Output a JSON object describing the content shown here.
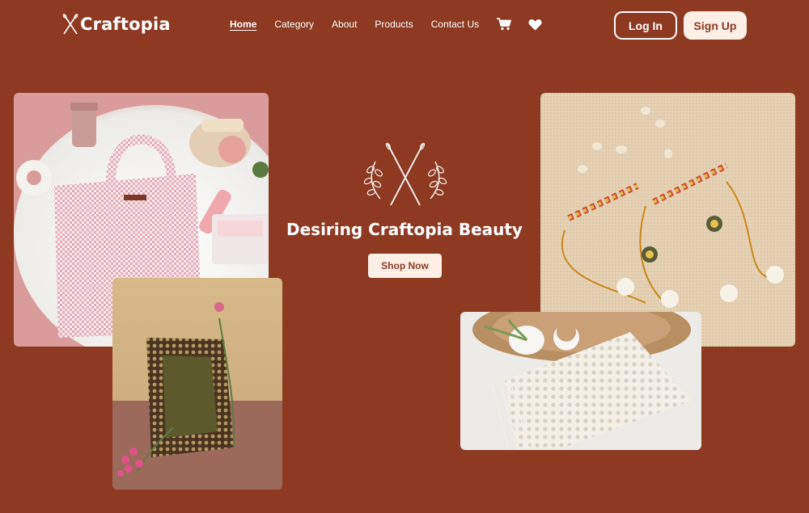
{
  "brand": {
    "name": "Craftopia"
  },
  "nav": {
    "links": [
      {
        "label": "Home",
        "active": true
      },
      {
        "label": "Category"
      },
      {
        "label": "About"
      },
      {
        "label": "Products"
      },
      {
        "label": "Contact Us"
      }
    ],
    "icons": [
      "cart-icon",
      "heart-icon"
    ]
  },
  "auth": {
    "login_label": "Log In",
    "signup_label": "Sign Up"
  },
  "hero": {
    "title": "Desiring Craftopia Beauty",
    "cta_label": "Shop Now"
  },
  "colors": {
    "background": "#8e3a23",
    "accent_light": "#fdeee6",
    "text": "#ffffff"
  }
}
